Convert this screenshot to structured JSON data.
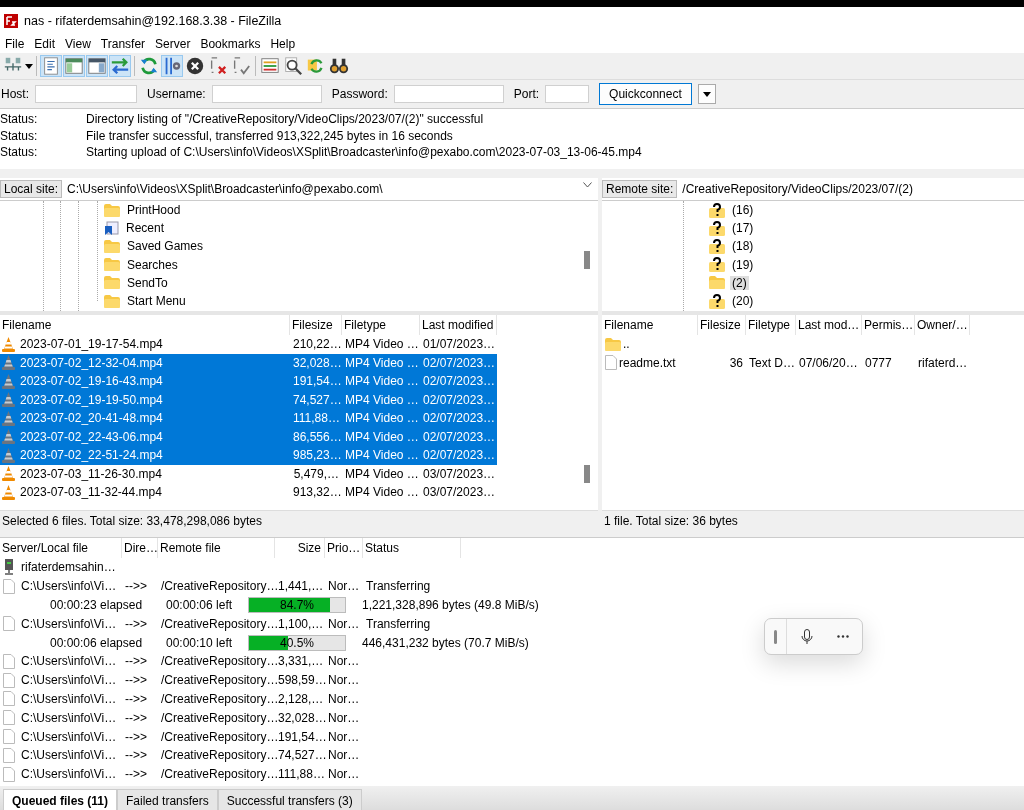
{
  "window": {
    "title": "nas - rifaterdemsahin@192.168.3.38 - FileZilla"
  },
  "menu": [
    "File",
    "Edit",
    "View",
    "Transfer",
    "Server",
    "Bookmarks",
    "Help"
  ],
  "toolbar": [
    {
      "kind": "site-manager",
      "on": false
    },
    {
      "kind": "message-log",
      "on": true
    },
    {
      "kind": "local-tree",
      "on": true
    },
    {
      "kind": "remote-tree",
      "on": true
    },
    {
      "kind": "queue",
      "on": true
    },
    {
      "kind": "refresh",
      "on": false
    },
    {
      "kind": "filter",
      "on": true
    },
    {
      "kind": "cancel",
      "on": false
    },
    {
      "kind": "disconnect",
      "on": false
    },
    {
      "kind": "reconnect",
      "on": false
    },
    {
      "kind": "compare",
      "on": false
    },
    {
      "kind": "search",
      "on": false
    },
    {
      "kind": "sync",
      "on": false
    },
    {
      "kind": "find",
      "on": false
    }
  ],
  "quickconnect": {
    "host_label": "Host:",
    "username_label": "Username:",
    "password_label": "Password:",
    "port_label": "Port:",
    "button": "Quickconnect"
  },
  "log": [
    {
      "label": "Status:",
      "message": "Directory listing of \"/CreativeRepository/VideoClips/2023/07/(2)\" successful"
    },
    {
      "label": "Status:",
      "message": "File transfer successful, transferred 913,322,245 bytes in 16 seconds"
    },
    {
      "label": "Status:",
      "message": "Starting upload of C:\\Users\\info\\Videos\\XSplit\\Broadcaster\\info@pexabo.com\\2023-07-03_13-06-45.mp4"
    }
  ],
  "local": {
    "site_label": "Local site:",
    "path": "C:\\Users\\info\\Videos\\XSplit\\Broadcaster\\info@pexabo.com\\",
    "tree": [
      {
        "name": "PrintHood",
        "kind": "folder",
        "selected": false
      },
      {
        "name": "Recent",
        "kind": "recent",
        "selected": false
      },
      {
        "name": "Saved Games",
        "kind": "folder",
        "selected": false
      },
      {
        "name": "Searches",
        "kind": "folder",
        "selected": false
      },
      {
        "name": "SendTo",
        "kind": "folder",
        "selected": false
      },
      {
        "name": "Start Menu",
        "kind": "folder",
        "selected": false
      }
    ],
    "columns": [
      "Filename",
      "Filesize",
      "Filetype",
      "Last modified"
    ],
    "files": [
      {
        "name": "2023-07-01_19-17-54.mp4",
        "size": "210,22…",
        "type": "MP4 Video …",
        "modified": "01/07/2023…",
        "selected": false
      },
      {
        "name": "2023-07-02_12-32-04.mp4",
        "size": "32,028…",
        "type": "MP4 Video …",
        "modified": "02/07/2023…",
        "selected": true
      },
      {
        "name": "2023-07-02_19-16-43.mp4",
        "size": "191,54…",
        "type": "MP4 Video …",
        "modified": "02/07/2023…",
        "selected": true
      },
      {
        "name": "2023-07-02_19-19-50.mp4",
        "size": "74,527…",
        "type": "MP4 Video …",
        "modified": "02/07/2023…",
        "selected": true
      },
      {
        "name": "2023-07-02_20-41-48.mp4",
        "size": "111,88…",
        "type": "MP4 Video …",
        "modified": "02/07/2023…",
        "selected": true
      },
      {
        "name": "2023-07-02_22-43-06.mp4",
        "size": "86,556…",
        "type": "MP4 Video …",
        "modified": "02/07/2023…",
        "selected": true
      },
      {
        "name": "2023-07-02_22-51-24.mp4",
        "size": "985,23…",
        "type": "MP4 Video …",
        "modified": "02/07/2023…",
        "selected": true
      },
      {
        "name": "2023-07-03_11-26-30.mp4",
        "size": "5,479,…",
        "type": "MP4 Video …",
        "modified": "03/07/2023…",
        "selected": false
      },
      {
        "name": "2023-07-03_11-32-44.mp4",
        "size": "913,32…",
        "type": "MP4 Video …",
        "modified": "03/07/2023…",
        "selected": false
      }
    ],
    "status": "Selected 6 files. Total size: 33,478,298,086 bytes"
  },
  "remote": {
    "site_label": "Remote site:",
    "path": "/CreativeRepository/VideoClips/2023/07/(2)",
    "tree": [
      {
        "name": "(16)",
        "kind": "unknown",
        "selected": false
      },
      {
        "name": "(17)",
        "kind": "unknown",
        "selected": false
      },
      {
        "name": "(18)",
        "kind": "unknown",
        "selected": false
      },
      {
        "name": "(19)",
        "kind": "unknown",
        "selected": false
      },
      {
        "name": "(2)",
        "kind": "folder",
        "selected": true
      },
      {
        "name": "(20)",
        "kind": "unknown",
        "selected": false
      }
    ],
    "columns": [
      "Filename",
      "Filesize",
      "Filetype",
      "Last mod…",
      "Permis…",
      "Owner/…"
    ],
    "files": [
      {
        "kind": "parent",
        "name": ".."
      },
      {
        "kind": "file",
        "name": "readme.txt",
        "size": "36",
        "type": "Text D…",
        "modified": "07/06/20…",
        "permissions": "0777",
        "owner": "rifaterd…"
      }
    ],
    "status": "1 file. Total size: 36 bytes"
  },
  "queue": {
    "columns": [
      "Server/Local file",
      "Dire…",
      "Remote file",
      "Size",
      "Prio…",
      "Status"
    ],
    "server": "rifaterdemsahin…",
    "items": [
      {
        "kind": "file",
        "local": "C:\\Users\\info\\Vi…",
        "direction": "-->>",
        "remote": "/CreativeRepository…",
        "size": "1,441,…",
        "priority": "Nor…",
        "status": "Transferring"
      },
      {
        "kind": "progress",
        "elapsed": "00:00:23 elapsed",
        "left": "00:00:06 left",
        "level": 0.847,
        "percent": "84.7%",
        "bytes": "1,221,328,896 bytes (49.8 MiB/s)"
      },
      {
        "kind": "file",
        "local": "C:\\Users\\info\\Vi…",
        "direction": "-->>",
        "remote": "/CreativeRepository…",
        "size": "1,100,…",
        "priority": "Nor…",
        "status": "Transferring"
      },
      {
        "kind": "progress",
        "elapsed": "00:00:06 elapsed",
        "left": "00:00:10 left",
        "level": 0.405,
        "percent": "40.5%",
        "bytes": "446,431,232 bytes (70.7 MiB/s)"
      },
      {
        "kind": "file",
        "local": "C:\\Users\\info\\Vi…",
        "direction": "-->>",
        "remote": "/CreativeRepository…",
        "size": "3,331,…",
        "priority": "Nor…"
      },
      {
        "kind": "file",
        "local": "C:\\Users\\info\\Vi…",
        "direction": "-->>",
        "remote": "/CreativeRepository…",
        "size": "598,59…",
        "priority": "Nor…"
      },
      {
        "kind": "file",
        "local": "C:\\Users\\info\\Vi…",
        "direction": "-->>",
        "remote": "/CreativeRepository…",
        "size": "2,128,…",
        "priority": "Nor…"
      },
      {
        "kind": "file",
        "local": "C:\\Users\\info\\Vi…",
        "direction": "-->>",
        "remote": "/CreativeRepository…",
        "size": "32,028…",
        "priority": "Nor…"
      },
      {
        "kind": "file",
        "local": "C:\\Users\\info\\Vi…",
        "direction": "-->>",
        "remote": "/CreativeRepository…",
        "size": "191,54…",
        "priority": "Nor…"
      },
      {
        "kind": "file",
        "local": "C:\\Users\\info\\Vi…",
        "direction": "-->>",
        "remote": "/CreativeRepository…",
        "size": "74,527…",
        "priority": "Nor…"
      },
      {
        "kind": "file",
        "local": "C:\\Users\\info\\Vi…",
        "direction": "-->>",
        "remote": "/CreativeRepository…",
        "size": "111,88…",
        "priority": "Nor…"
      }
    ]
  },
  "tabs": [
    {
      "label": "Queued files (11)",
      "selected": true
    },
    {
      "label": "Failed transfers",
      "selected": false
    },
    {
      "label": "Successful transfers (3)",
      "selected": false
    }
  ]
}
